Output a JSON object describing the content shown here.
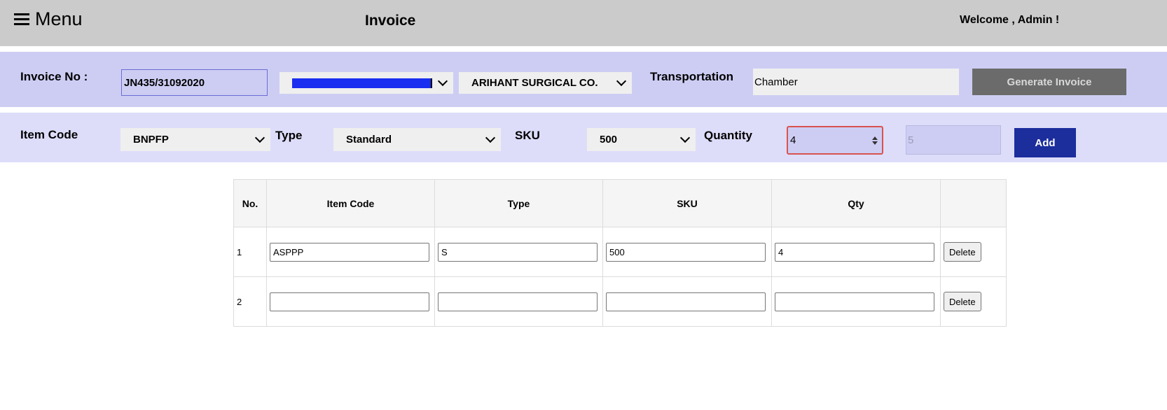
{
  "header": {
    "menu_label": "Menu",
    "title": "Invoice",
    "welcome": "Welcome , Admin !"
  },
  "invoice_bar": {
    "invoice_no_label": "Invoice No :",
    "invoice_no_value": "JN435/31092020",
    "supplier_value": "ARIHANT SURGICAL CO.",
    "transportation_label": "Transportation",
    "transportation_value": "Chamber",
    "generate_button": "Generate Invoice"
  },
  "item_bar": {
    "item_code_label": "Item Code",
    "item_code_value": "BNPFP",
    "type_label": "Type",
    "type_value": "Standard",
    "sku_label": "SKU",
    "sku_value": "500",
    "quantity_label": "Quantity",
    "quantity_value": "4",
    "stock_value": "5",
    "add_button": "Add"
  },
  "table": {
    "headers": [
      "No.",
      "Item Code",
      "Type",
      "SKU",
      "Qty",
      ""
    ],
    "rows": [
      {
        "no": "1",
        "item_code": "ASPPP",
        "type": "S",
        "sku": "500",
        "qty": "4",
        "action": "Delete"
      },
      {
        "no": "2",
        "item_code": "",
        "type": "",
        "sku": "",
        "qty": "",
        "action": "Delete"
      }
    ]
  },
  "colors": {
    "header_bg": "#cbcbcb",
    "invoice_bar_bg": "#cdcdf4",
    "item_bar_bg": "#ddddfa",
    "add_button_bg": "#1c2d9c",
    "generate_button_bg": "#6b6b6b"
  }
}
